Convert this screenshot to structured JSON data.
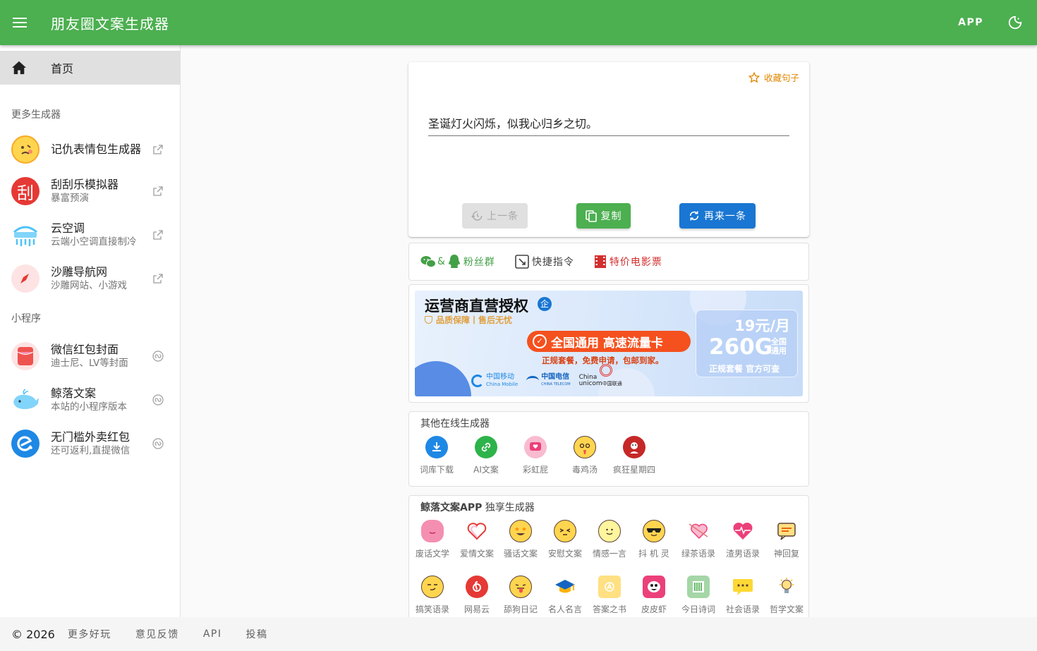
{
  "topbar": {
    "title": "朋友圈文案生成器",
    "app_label": "APP"
  },
  "sidebar": {
    "home_label": "首页",
    "section_more": "更多生成器",
    "section_mini": "小程序",
    "items": [
      {
        "title": "记仇表情包生成器",
        "subtitle": ""
      },
      {
        "title": "刮刮乐模拟器",
        "subtitle": "暴富预演",
        "avatar_text": "刮"
      },
      {
        "title": "云空调",
        "subtitle": "云端小空调直接制冷"
      },
      {
        "title": "沙雕导航网",
        "subtitle": "沙雕网站、小游戏"
      },
      {
        "title": "微信红包封面",
        "subtitle": "迪士尼、LV等封面"
      },
      {
        "title": "鲸落文案",
        "subtitle": "本站的小程序版本"
      },
      {
        "title": "无门槛外卖红包",
        "subtitle": "还可返利,直提微信"
      }
    ]
  },
  "quote_card": {
    "fav_label": "收藏句子",
    "text": "圣诞灯火闪烁，似我心归乡之切。",
    "prev_label": "上一条",
    "copy_label": "复制",
    "next_label": "再来一条"
  },
  "links": {
    "group_label": "粉丝群",
    "amp": "&",
    "shortcut_label": "快捷指令",
    "movie_label": "特价电影票"
  },
  "ad": {
    "headline": "运营商直营授权",
    "badge": "企",
    "tagline": "品质保障丨售后无忧",
    "pill": "全国通用 高速流量卡",
    "subline": "正规套餐，免费申请，包邮到家。",
    "price": "19元/月",
    "data": "260G",
    "data_note1": "全国",
    "data_note2": "通用",
    "note": "正规套餐 官方可查",
    "carrier1": "中国移动",
    "carrier1_en": "China Mobile",
    "carrier2": "中国电信",
    "carrier2_en": "CHINA TELECOM",
    "carrier3_en": "China",
    "carrier3_en2": "unicom",
    "carrier3": "中国联通"
  },
  "other": {
    "title": "其他在线生成器",
    "items": [
      "词库下载",
      "AI文案",
      "彩虹屁",
      "毒鸡汤",
      "疯狂星期四"
    ]
  },
  "exclusive": {
    "title_bold": "鲸落文案APP",
    "title_rest": " 独享生成器",
    "row1": [
      "废话文学",
      "爱情文案",
      "骚话文案",
      "安慰文案",
      "情感一言",
      "抖 机 灵",
      "绿茶语录",
      "渣男语录",
      "神回复"
    ],
    "row2": [
      "搞笑语录",
      "网易云",
      "舔狗日记",
      "名人名言",
      "答案之书",
      "皮皮虾",
      "今日诗词",
      "社会语录",
      "哲学文案"
    ]
  },
  "footer": {
    "copyright": "© 2026",
    "links": [
      "更多好玩",
      "意见反馈",
      "API",
      "投稿"
    ]
  },
  "colors": {
    "primary": "#4caf50",
    "accent_blue": "#1976d2",
    "fav_orange": "#e08600",
    "movie_red": "#d32f2f"
  }
}
